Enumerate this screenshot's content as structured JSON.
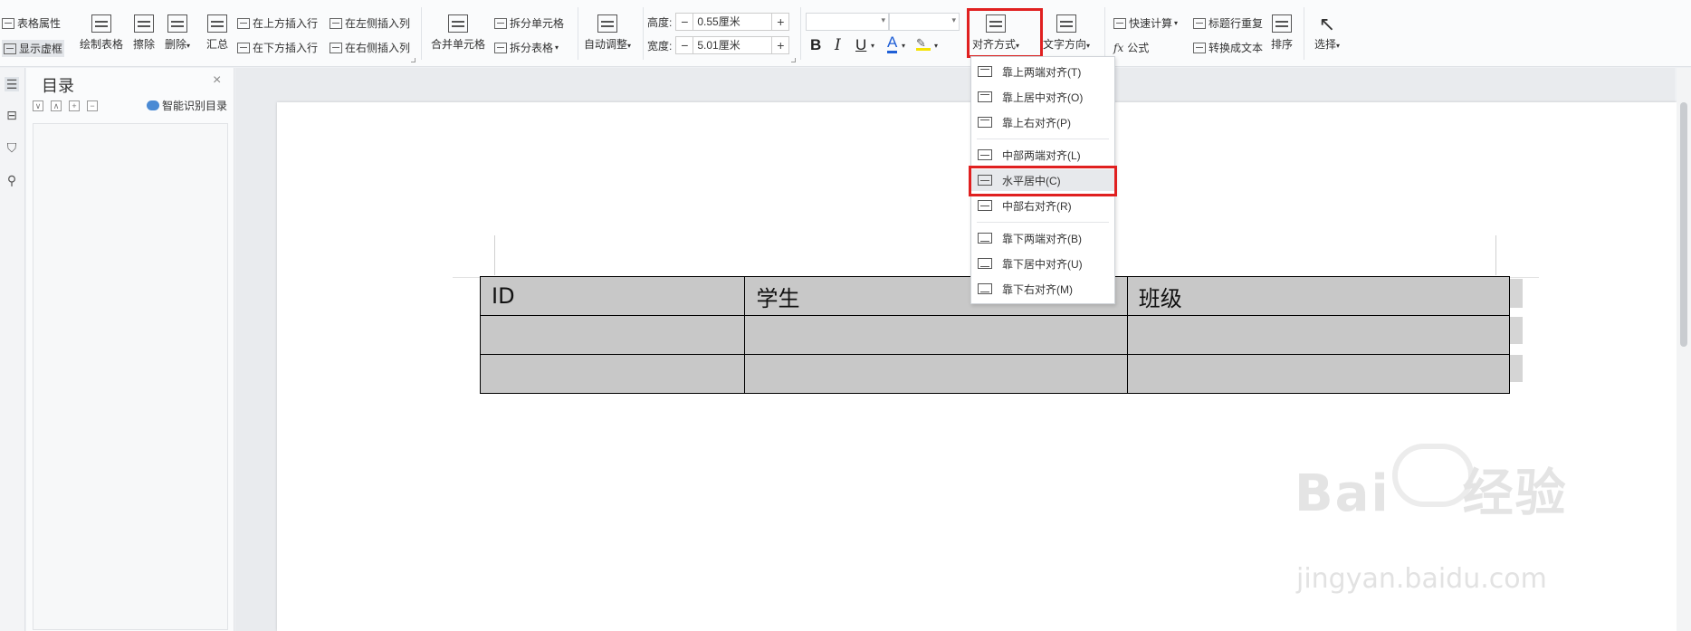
{
  "toolbar": {
    "table_props": "表格属性",
    "show_gridlines": "显示虚框",
    "draw_table": "绘制表格",
    "erase": "擦除",
    "delete": "删除",
    "summary": "汇总",
    "insert_above": "在上方插入行",
    "insert_below": "在下方插入行",
    "insert_left": "在左侧插入列",
    "insert_right": "在右侧插入列",
    "merge_cells": "合并单元格",
    "split_cells": "拆分单元格",
    "split_table": "拆分表格",
    "auto_adjust": "自动调整",
    "height_label": "高度:",
    "height_value": "0.55厘米",
    "width_label": "宽度:",
    "width_value": "5.01厘米",
    "minus": "−",
    "plus": "+",
    "bold": "B",
    "italic": "I",
    "underline": "U",
    "font_color": "A",
    "alignment": "对齐方式",
    "text_direction": "文字方向",
    "quick_calc": "快速计算",
    "formula": "公式",
    "repeat_header": "标题行重复",
    "convert_text": "转换成文本",
    "sort": "排序",
    "select": "选择"
  },
  "toc": {
    "title": "目录",
    "ai_toc": "智能识别目录",
    "close": "×"
  },
  "dropdown": {
    "items": [
      {
        "label": "靠上两端对齐(T)",
        "pos": "t"
      },
      {
        "label": "靠上居中对齐(O)",
        "pos": "t"
      },
      {
        "label": "靠上右对齐(P)",
        "pos": "t"
      },
      {
        "label": "中部两端对齐(L)",
        "pos": "m"
      },
      {
        "label": "水平居中(C)",
        "pos": "m"
      },
      {
        "label": "中部右对齐(R)",
        "pos": "m"
      },
      {
        "label": "靠下两端对齐(B)",
        "pos": "b"
      },
      {
        "label": "靠下居中对齐(U)",
        "pos": "b"
      },
      {
        "label": "靠下右对齐(M)",
        "pos": "b"
      }
    ],
    "highlighted_index": 4
  },
  "table": {
    "headers": [
      "ID",
      "学生",
      "班级"
    ],
    "rows": [
      [
        "",
        "",
        ""
      ],
      [
        "",
        "",
        ""
      ]
    ]
  },
  "watermark": {
    "brand": "Bai",
    "brand2": "经验",
    "url": "jingyan.baidu.com"
  },
  "colors": {
    "highlight_box": "#e02020",
    "table_fill": "#c8c8c8",
    "font_color_bar": "#1f5fd6",
    "highlight_color_bar": "#f5e200"
  }
}
